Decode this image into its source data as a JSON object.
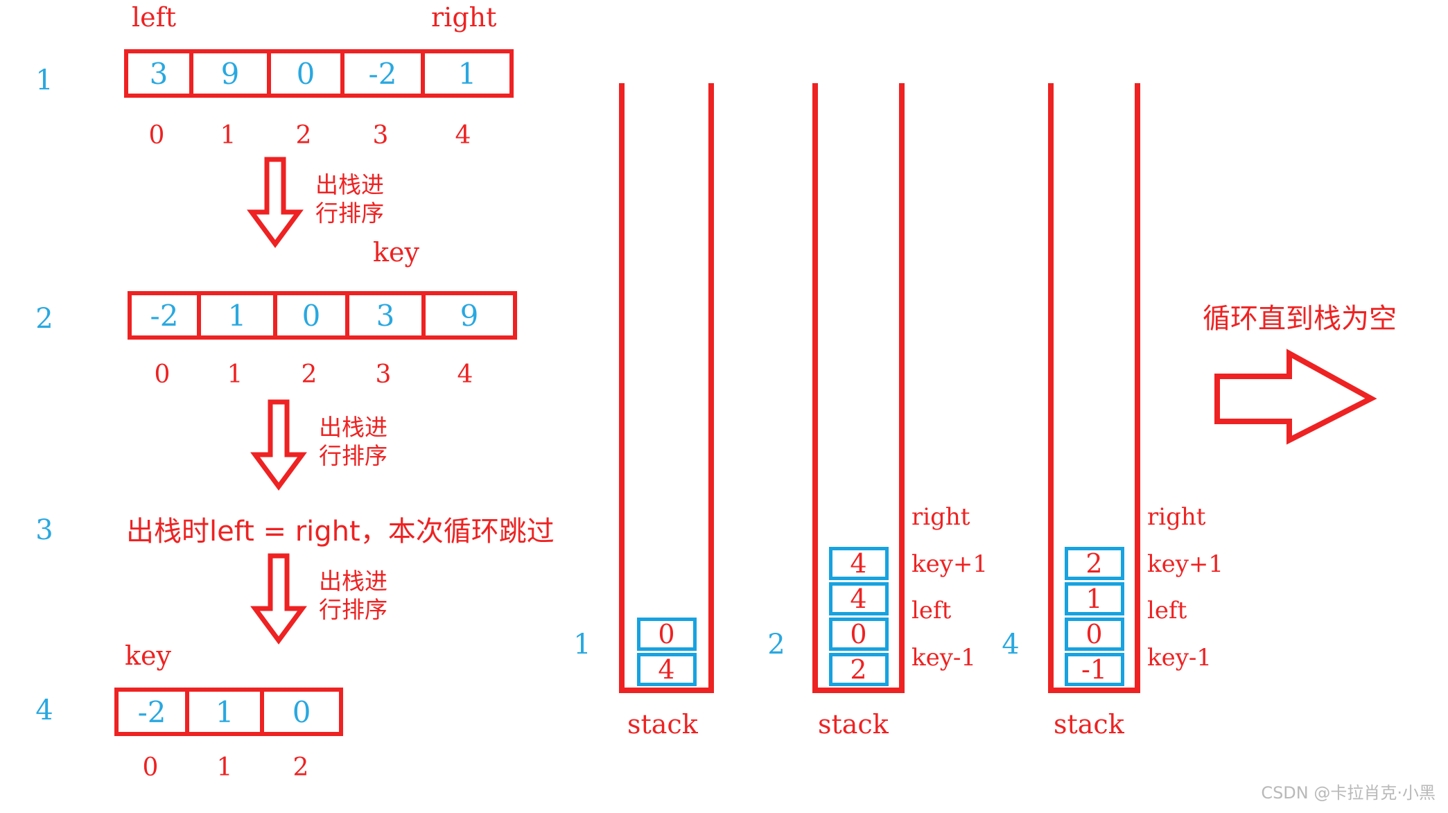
{
  "left_panel": {
    "pointer_labels": {
      "left": "left",
      "right": "right",
      "key": "key"
    },
    "steps": [
      {
        "number": "1",
        "values": [
          "3",
          "9",
          "0",
          "-2",
          "1"
        ],
        "indices": [
          "0",
          "1",
          "2",
          "3",
          "4"
        ]
      },
      {
        "number": "2",
        "values": [
          "-2",
          "1",
          "0",
          "3",
          "9"
        ],
        "indices": [
          "0",
          "1",
          "2",
          "3",
          "4"
        ]
      },
      {
        "number": "3",
        "note": "出栈时left = right，本次循环跳过"
      },
      {
        "number": "4",
        "values": [
          "-2",
          "1",
          "0"
        ],
        "indices": [
          "0",
          "1",
          "2"
        ]
      }
    ],
    "arrow_notes": [
      {
        "line1": "出栈进",
        "line2": "行排序"
      },
      {
        "line1": "出栈进",
        "line2": "行排序"
      },
      {
        "line1": "出栈进",
        "line2": "行排序"
      }
    ]
  },
  "right_panel": {
    "stack_caption": "stack",
    "loop_note": "循环直到栈为空",
    "stacks": [
      {
        "number": "1",
        "cells": [
          {
            "value": "0",
            "label": ""
          },
          {
            "value": "4",
            "label": ""
          }
        ]
      },
      {
        "number": "2",
        "cells": [
          {
            "value": "4",
            "label": "right"
          },
          {
            "value": "4",
            "label": "key+1"
          },
          {
            "value": "0",
            "label": "left"
          },
          {
            "value": "2",
            "label": "key-1"
          }
        ]
      },
      {
        "number": "4",
        "cells": [
          {
            "value": "2",
            "label": "right"
          },
          {
            "value": "1",
            "label": "key+1"
          },
          {
            "value": "0",
            "label": "left"
          },
          {
            "value": "-1",
            "label": "key-1"
          }
        ]
      }
    ]
  },
  "watermark": "CSDN @卡拉肖克·小黑",
  "colors": {
    "red": "#ee2222",
    "blue_value": "#29a8e0",
    "blue_border": "#17a2e0",
    "watermark_gray": "#b9b9b9"
  }
}
